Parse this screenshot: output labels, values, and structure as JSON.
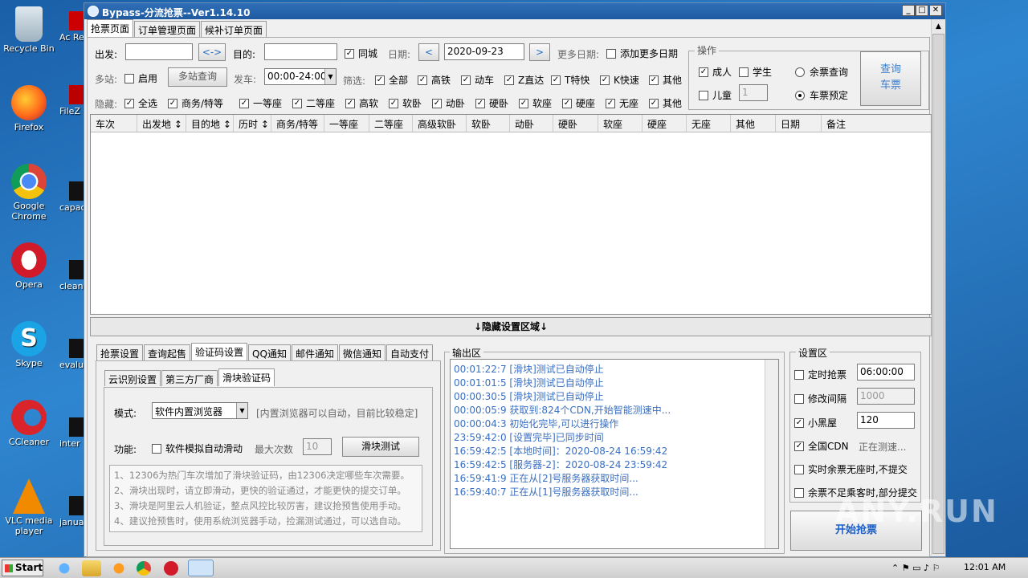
{
  "colors": {
    "desktop": "#2a6fb0",
    "title_bar": "#1f5aa0",
    "log_text": "#3a6fc2",
    "start_btn_text": "#1a5fc8"
  },
  "desktop_icons": [
    {
      "label": "Recycle Bin",
      "icon": "recycle-bin-icon"
    },
    {
      "label": "Firefox",
      "icon": "firefox-icon"
    },
    {
      "label": "Google Chrome",
      "icon": "chrome-icon"
    },
    {
      "label": "Opera",
      "icon": "opera-icon"
    },
    {
      "label": "Skype",
      "icon": "skype-icon"
    },
    {
      "label": "CCleaner",
      "icon": "ccleaner-icon"
    },
    {
      "label": "VLC media player",
      "icon": "vlc-icon"
    }
  ],
  "desktop_icons2": [
    "Ac Rea",
    "FileZ",
    "capac",
    "clean",
    "evalu",
    "inter",
    "janua"
  ],
  "window": {
    "title": "Bypass-分流抢票--Ver1.14.10"
  },
  "main_tabs": [
    "抢票页面",
    "订单管理页面",
    "候补订单页面"
  ],
  "query": {
    "from_label": "出发:",
    "from_value": "",
    "swap_label": "<->",
    "to_label": "目的:",
    "to_value": "",
    "same_city": "同城",
    "date_label": "日期:",
    "date_value": "2020-09-23",
    "prev": "<",
    "next": ">",
    "more_dates_label": "更多日期:",
    "add_more_dates": "添加更多日期",
    "multi_label": "多站:",
    "enable": "启用",
    "multi_btn": "多站查询",
    "depart_label": "发车:",
    "depart_value": "00:00-24:00",
    "filter_label": "筛选:",
    "filters": [
      "全部",
      "高铁",
      "动车",
      "Z直达",
      "T特快",
      "K快速",
      "其他"
    ],
    "hide_label": "隐藏:",
    "hides": [
      "全选",
      "商务/特等",
      "一等座",
      "二等座",
      "高软",
      "软卧",
      "动卧",
      "硬卧",
      "软座",
      "硬座",
      "无座",
      "其他"
    ]
  },
  "ops": {
    "title": "操作",
    "adult": "成人",
    "student": "学生",
    "child": "儿童",
    "child_count": "1",
    "remain_query": "余票查询",
    "book": "车票预定",
    "query_btn_1": "查询",
    "query_btn_2": "车票"
  },
  "table_headers": [
    "车次",
    "出发地 ↕",
    "目的地 ↕",
    "历时 ↕",
    "商务/特等",
    "一等座",
    "二等座",
    "高级软卧",
    "软卧",
    "动卧",
    "硬卧",
    "软座",
    "硬座",
    "无座",
    "其他",
    "日期",
    "备注"
  ],
  "hide_bar": "↓隐藏设置区域↓",
  "settings_tabs": [
    "抢票设置",
    "查询起售",
    "验证码设置",
    "QQ通知",
    "邮件通知",
    "微信通知",
    "自动支付"
  ],
  "captcha_tabs": [
    "云识别设置",
    "第三方厂商",
    "滑块验证码"
  ],
  "captcha": {
    "mode_label": "模式:",
    "mode_value": "软件内置浏览器",
    "mode_hint": "[内置浏览器可以自动，目前比较稳定]",
    "func_label": "功能:",
    "auto_slide": "软件模拟自动滑动",
    "max_label": "最大次数",
    "max_value": "10",
    "test_btn": "滑块测试",
    "notes": [
      "1、12306为热门车次增加了滑块验证码，由12306决定哪些车次需要。",
      "2、滑块出现时，请立即滑动，更快的验证通过，才能更快的提交订单。",
      "3、滑块是阿里云人机验证，整点风控比较厉害，建议抢预售使用手动。",
      "4、建议抢预售时，使用系统浏览器手动，捡漏测试通过，可以选自动。"
    ]
  },
  "output": {
    "title": "输出区",
    "lines": [
      "00:01:22:7  [滑块]测试已自动停止",
      "00:01:01:5  [滑块]测试已自动停止",
      "00:00:30:5  [滑块]测试已自动停止",
      "00:00:05:9  获取到:824个CDN,开始智能测速中...",
      "00:00:04:3  初始化完毕,可以进行操作",
      "23:59:42:0  [设置完毕]已同步时间",
      "16:59:42:5  [本地时间]：2020-08-24 16:59:42",
      "16:59:42:5  [服务器-2]：2020-08-24 23:59:42",
      "16:59:41:9  正在从[2]号服务器获取时间...",
      "16:59:40:7  正在从[1]号服务器获取时间..."
    ]
  },
  "settings": {
    "title": "设置区",
    "timed": "定时抢票",
    "timed_value": "06:00:00",
    "interval": "修改间隔",
    "interval_value": "1000",
    "blacklist": "小黑屋",
    "blacklist_value": "120",
    "cdn": "全国CDN",
    "cdn_status": "正在测速...",
    "no_submit": "实时余票无座时,不提交",
    "partial": "余票不足乘客时,部分提交",
    "start_btn": "开始抢票"
  },
  "taskbar": {
    "start": "Start",
    "time": "12:01 AM"
  },
  "watermark": "ANY.RUN"
}
